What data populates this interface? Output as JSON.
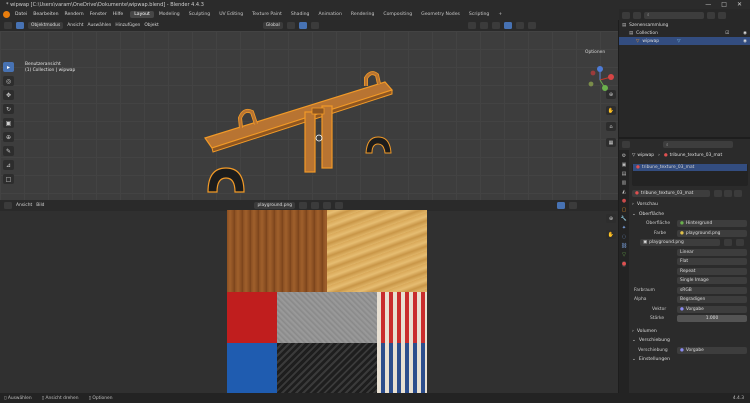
{
  "window": {
    "title": "* wipwap [C:\\Users\\varam\\OneDrive\\Dokumente\\wipwap.blend] - Blender 4.4.3",
    "controls": [
      "—",
      "□",
      "✕"
    ]
  },
  "menu": [
    "Datei",
    "Bearbeiten",
    "Rendern",
    "Fenster",
    "Hilfe"
  ],
  "workspaces": {
    "tabs": [
      "Layout",
      "Modeling",
      "Sculpting",
      "UV Editing",
      "Texture Paint",
      "Shading",
      "Animation",
      "Rendering",
      "Compositing",
      "Geometry Nodes",
      "Scripting"
    ],
    "active": "Layout",
    "add": "+",
    "scene": "Scene",
    "view_layer": "ViewLayer"
  },
  "viewport3d": {
    "mode": "Objektmodus",
    "menus": [
      "Ansicht",
      "Auswählen",
      "Hinzufügen",
      "Objekt"
    ],
    "orientation": "Global",
    "options": "Optionen",
    "info_line1": "Benutzeransicht",
    "info_line2": "(1) Collection | wipwap",
    "gizmo": {
      "x": "X",
      "y": "Y",
      "z": "Z"
    },
    "colors": {
      "selection": "#f29a27",
      "wood": "#b5712f"
    }
  },
  "image_editor": {
    "menus": [
      "Ansicht",
      "Bild"
    ],
    "image_name": "playground.png"
  },
  "outliner": {
    "search_placeholder": "",
    "rows": [
      {
        "label": "Szenensammlung",
        "selected": false,
        "indent": 0
      },
      {
        "label": "Collection",
        "selected": false,
        "indent": 1
      },
      {
        "label": "wipwap",
        "selected": true,
        "indent": 2
      }
    ]
  },
  "properties": {
    "breadcrumb_object": "wipwap",
    "breadcrumb_material": "tribune_texture_03_mat",
    "slot": "tribune_texture_03_mat",
    "material_field": "tribune_texture_03_mat",
    "sections": {
      "preview": "Vorschau",
      "surface": "Oberfläche",
      "volume": "Volumen",
      "displacement": "Verschiebung",
      "settings": "Einstellungen"
    },
    "surface_label": "Oberfläche",
    "surface_value": "Hintergrund",
    "color_label": "Farbe",
    "color_value": "playground.png",
    "image_field": "playground.png",
    "interp": "Linear",
    "projection": "Flat",
    "extension": "Repeat",
    "source": "Single Image",
    "colorspace_label": "Farbraum",
    "colorspace_value": "sRGB",
    "alpha_label": "Alpha",
    "alpha_value": "Begradigen",
    "vector_label": "Vektor",
    "vector_value": "Vorgabe",
    "strength_label": "Stärke",
    "strength_value": "1.000",
    "displacement_label": "Verschiebung",
    "displacement_value": "Vorgabe"
  },
  "statusbar": {
    "items": [
      "Auswählen",
      "Ansicht drehen",
      "Optionen"
    ],
    "version": "4.4.3"
  }
}
